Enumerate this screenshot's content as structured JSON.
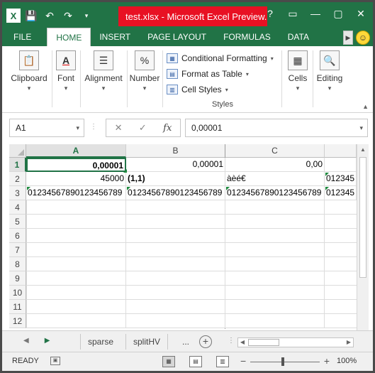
{
  "window": {
    "title": "test.xlsx - Microsoft Excel Preview..."
  },
  "qat": {
    "app_icon": "excel-logo",
    "logo_text": "X"
  },
  "window_controls": [
    "?",
    "▭",
    "—",
    "▢",
    "✕"
  ],
  "ribbon_tabs": [
    "FILE",
    "HOME",
    "INSERT",
    "PAGE LAYOUT",
    "FORMULAS",
    "DATA"
  ],
  "active_tab": "HOME",
  "ribbon": {
    "clipboard": "Clipboard",
    "font": "Font",
    "alignment": "Alignment",
    "number": "Number",
    "number_symbol": "%",
    "styles_items": [
      "Conditional Formatting",
      "Format as Table",
      "Cell Styles"
    ],
    "styles_caption": "Styles",
    "cells": "Cells",
    "editing": "Editing"
  },
  "formula_bar": {
    "name_box": "A1",
    "formula": "0,00001"
  },
  "columns": [
    "A",
    "B",
    "C"
  ],
  "rows": [
    "1",
    "2",
    "3",
    "4",
    "5",
    "6",
    "7",
    "8",
    "9",
    "10",
    "11",
    "12"
  ],
  "cells": {
    "A1": "0,00001",
    "B1": "0,00001",
    "C1": "0,00",
    "A2": "45000",
    "B2": "(1,1)",
    "C2": "àèé€",
    "D2": "012345",
    "A3": "01234567890123456789",
    "B3": "01234567890123456789",
    "C3": "01234567890123456789",
    "D3": "012345"
  },
  "sheet_tabs": [
    "sparse",
    "splitHV"
  ],
  "sheet_more": "...",
  "status": {
    "mode": "READY",
    "zoom": "100%"
  },
  "colors": {
    "excel_green": "#217346",
    "title_red": "#e81123"
  }
}
